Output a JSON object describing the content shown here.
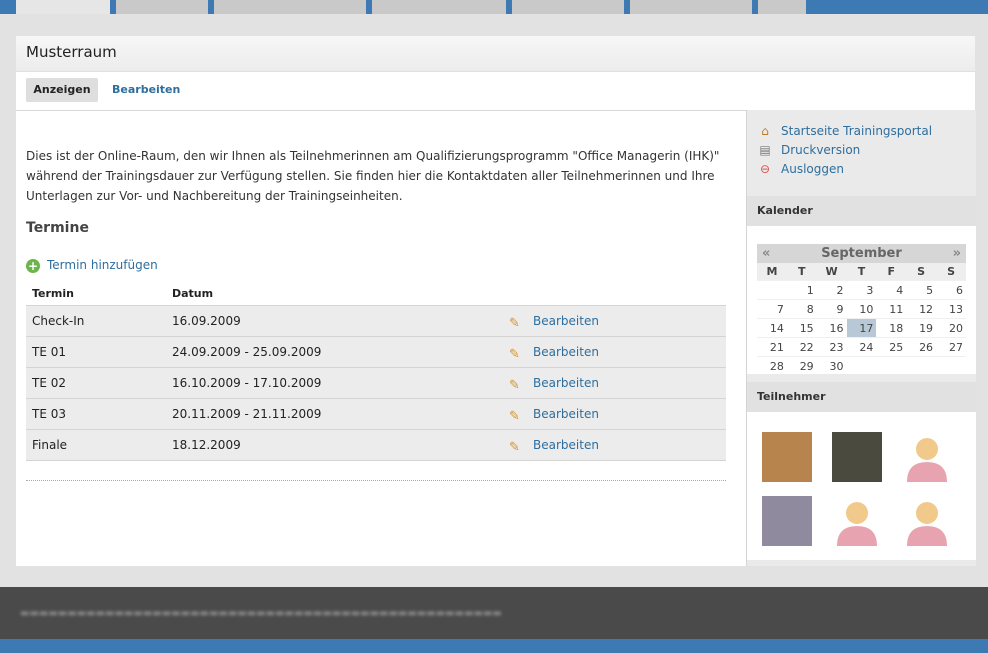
{
  "panel": {
    "title": "Musterraum"
  },
  "subtabs": {
    "active": "Anzeigen",
    "edit": "Bearbeiten"
  },
  "intro": "Dies ist der Online-Raum, den wir Ihnen als Teilnehmerinnen am Qualifizierungsprogramm \"Office Managerin (IHK)\" während der Trainingsdauer zur Verfügung stellen. Sie finden hier die Kontaktdaten aller Teilnehmerinnen und Ihre Unterlagen zur Vor- und Nachbereitung der Trainingseinheiten.",
  "termine": {
    "title": "Termine",
    "add_label": "Termin hinzufügen",
    "columns": [
      "Termin",
      "Datum"
    ],
    "rows": [
      {
        "termin": "Check-In",
        "datum": "16.09.2009",
        "action": "Bearbeiten"
      },
      {
        "termin": "TE 01",
        "datum": "24.09.2009 - 25.09.2009",
        "action": "Bearbeiten"
      },
      {
        "termin": "TE 02",
        "datum": "16.10.2009 - 17.10.2009",
        "action": "Bearbeiten"
      },
      {
        "termin": "TE 03",
        "datum": "20.11.2009 - 21.11.2009",
        "action": "Bearbeiten"
      },
      {
        "termin": "Finale",
        "datum": "18.12.2009",
        "action": "Bearbeiten"
      }
    ]
  },
  "sidebar": {
    "links": [
      {
        "label": "Startseite Trainingsportal",
        "icon": "home-icon"
      },
      {
        "label": "Druckversion",
        "icon": "printer-icon"
      },
      {
        "label": "Ausloggen",
        "icon": "logout-icon"
      }
    ],
    "calendar": {
      "title": "Kalender",
      "month": "September",
      "prev": "«",
      "next": "»",
      "weekdays": [
        "M",
        "T",
        "W",
        "T",
        "F",
        "S",
        "S"
      ],
      "weeks": [
        [
          "",
          "1",
          "2",
          "3",
          "4",
          "5",
          "6"
        ],
        [
          "7",
          "8",
          "9",
          "10",
          "11",
          "12",
          "13"
        ],
        [
          "14",
          "15",
          "16",
          "17",
          "18",
          "19",
          "20"
        ],
        [
          "21",
          "22",
          "23",
          "24",
          "25",
          "26",
          "27"
        ],
        [
          "28",
          "29",
          "30",
          "",
          "",
          "",
          ""
        ]
      ],
      "today": "17"
    },
    "participants": {
      "title": "Teilnehmer"
    }
  },
  "colors": {
    "accent": "#2e6e9e",
    "topbar": "#3d7ab3",
    "footer": "#4a4a4a"
  }
}
